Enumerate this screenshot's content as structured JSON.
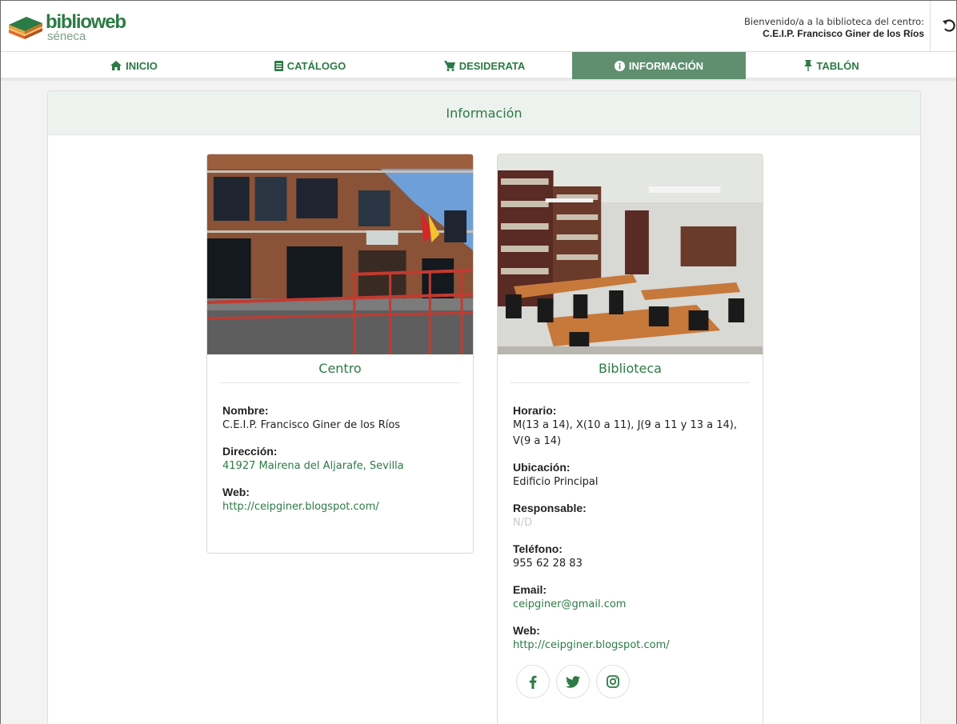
{
  "app": {
    "logo_main": "biblioweb",
    "logo_sub": "séneca"
  },
  "header": {
    "welcome": "Bienvenido/a a la biblioteca del centro:",
    "center_name": "C.E.I.P. Francisco Giner de los Ríos"
  },
  "nav": {
    "items": [
      {
        "label": "INICIO",
        "icon": "home-icon"
      },
      {
        "label": "CATÁLOGO",
        "icon": "book-icon"
      },
      {
        "label": "DESIDERATA",
        "icon": "cart-icon"
      },
      {
        "label": "INFORMACIÓN",
        "icon": "info-icon",
        "active": true
      },
      {
        "label": "TABLÓN",
        "icon": "pin-icon"
      }
    ]
  },
  "panel": {
    "title": "Información"
  },
  "centro": {
    "title": "Centro",
    "nombre_label": "Nombre:",
    "nombre": "C.E.I.P. Francisco Giner de los Ríos",
    "direccion_label": "Dirección:",
    "direccion": "41927 Mairena del Aljarafe, Sevilla",
    "web_label": "Web:",
    "web": "http://ceipginer.blogspot.com/"
  },
  "biblioteca": {
    "title": "Biblioteca",
    "horario_label": "Horario:",
    "horario": "M(13 a 14), X(10 a 11), J(9 a 11 y 13 a 14), V(9 a 14)",
    "ubicacion_label": "Ubicación:",
    "ubicacion": "Edificio Principal",
    "responsable_label": "Responsable:",
    "responsable": "N/D",
    "telefono_label": "Teléfono:",
    "telefono": "955 62 28 83",
    "email_label": "Email:",
    "email": "ceipginer@gmail.com",
    "web_label": "Web:",
    "web": "http://ceipginer.blogspot.com/",
    "social": [
      "facebook-icon",
      "twitter-icon",
      "instagram-icon"
    ]
  },
  "colors": {
    "brand_green": "#2c7a45",
    "active_tab": "#5f8f6f",
    "panel_header": "#eef2ef"
  }
}
